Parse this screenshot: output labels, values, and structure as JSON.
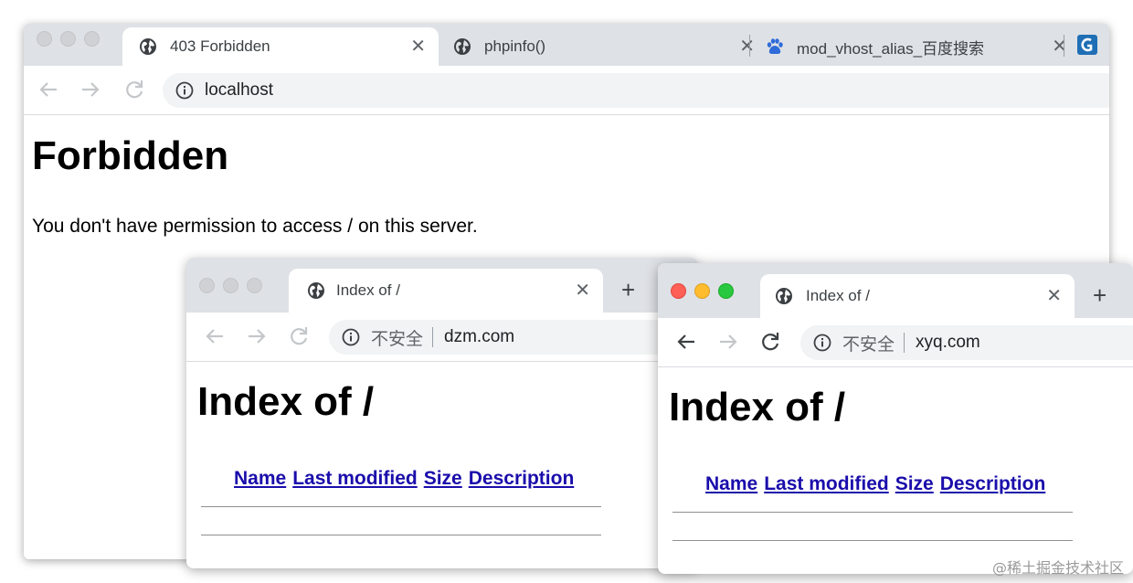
{
  "main_window": {
    "tabs": [
      {
        "title": "403 Forbidden",
        "icon": "globe-icon",
        "active": true
      },
      {
        "title": "phpinfo()",
        "icon": "globe-icon",
        "active": false
      },
      {
        "title": "mod_vhost_alias_百度搜索",
        "icon": "baidu-paw-icon",
        "active": false
      }
    ],
    "url": "localhost",
    "heading": "Forbidden",
    "message": "You don't have permission to access / on this server."
  },
  "window_dzm": {
    "tab_title": "Index of /",
    "security_label": "不安全",
    "url": "dzm.com",
    "heading": "Index of /",
    "columns": [
      "Name",
      "Last modified",
      "Size",
      "Description"
    ]
  },
  "window_xyq": {
    "tab_title": "Index of /",
    "security_label": "不安全",
    "url": "xyq.com",
    "heading": "Index of /",
    "columns": [
      "Name",
      "Last modified",
      "Size",
      "Description"
    ]
  },
  "watermark": "@稀土掘金技术社区",
  "colors": {
    "tabstrip": "#dee1e6",
    "omnibox": "#f1f3f4",
    "link": "#1a0dab",
    "traffic_red": "#fe5f57",
    "traffic_yellow": "#febc2e",
    "traffic_green": "#28c840"
  }
}
